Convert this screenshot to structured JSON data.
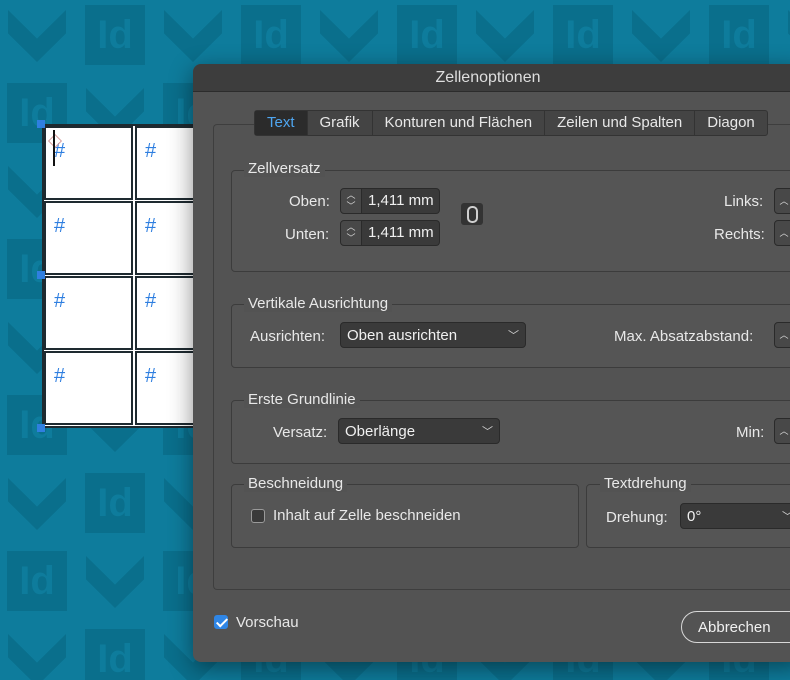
{
  "dialog": {
    "title": "Zellenoptionen",
    "tabs": [
      {
        "label": "Text",
        "active": true
      },
      {
        "label": "Grafik"
      },
      {
        "label": "Konturen und Flächen"
      },
      {
        "label": "Zeilen und Spalten"
      },
      {
        "label": "Diagon"
      }
    ],
    "zellversatz": {
      "title": "Zellversatz",
      "oben_label": "Oben:",
      "oben_value": "1,411 mm",
      "unten_label": "Unten:",
      "unten_value": "1,411 mm",
      "links_label": "Links:",
      "rechts_label": "Rechts:"
    },
    "vertikal": {
      "title": "Vertikale Ausrichtung",
      "ausrichten_label": "Ausrichten:",
      "ausrichten_value": "Oben ausrichten",
      "max_label": "Max. Absatzabstand:"
    },
    "grundlinie": {
      "title": "Erste Grundlinie",
      "versatz_label": "Versatz:",
      "versatz_value": "Oberlänge",
      "min_label": "Min:"
    },
    "beschneidung": {
      "title": "Beschneidung",
      "checkbox_label": "Inhalt auf Zelle beschneiden",
      "checked": false
    },
    "textdrehung": {
      "title": "Textdrehung",
      "drehung_label": "Drehung:",
      "drehung_value": "0°"
    },
    "vorschau": {
      "label": "Vorschau",
      "checked": true
    },
    "cancel_label": "Abbrechen"
  },
  "document": {
    "cell_marker": "#",
    "background_logo_text": "Id"
  },
  "colors": {
    "background": "#0e7c9c",
    "dialog": "#535353",
    "accent": "#4fa6f0",
    "cell_marker": "#2f7fe0"
  }
}
